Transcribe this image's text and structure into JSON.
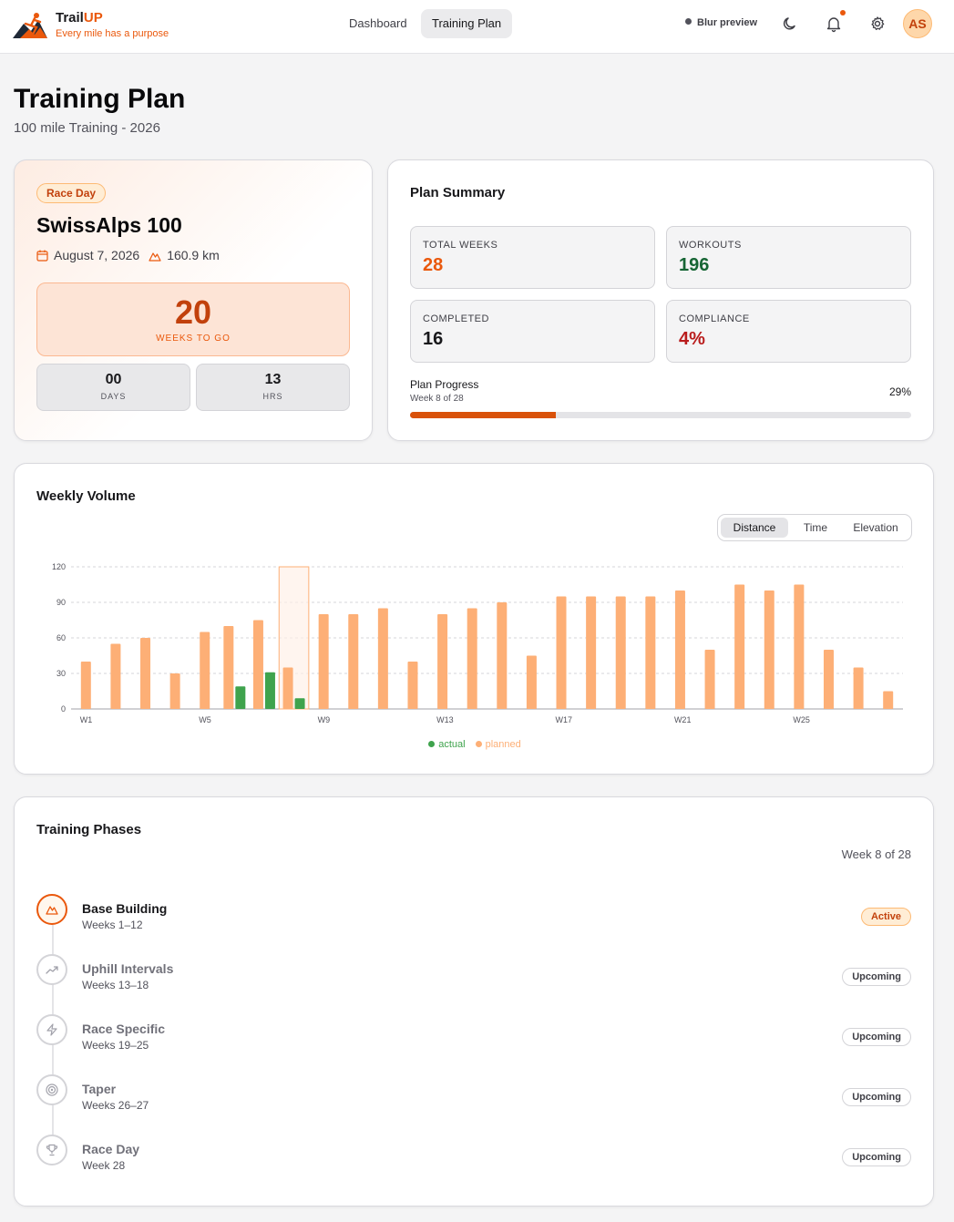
{
  "app": {
    "name_main": "Trail",
    "name_accent": "UP",
    "tagline": "Every mile has a purpose"
  },
  "nav": {
    "items": [
      {
        "label": "Dashboard",
        "active": false
      },
      {
        "label": "Training Plan",
        "active": true
      }
    ]
  },
  "header": {
    "blur_preview": "Blur preview",
    "avatar_initials": "AS",
    "icons": [
      "moon-icon",
      "bell-icon",
      "gear-icon"
    ]
  },
  "page": {
    "title": "Training Plan",
    "subtitle": "100 mile Training - 2026"
  },
  "race": {
    "badge": "Race Day",
    "name": "SwissAlps 100",
    "date": "August 7, 2026",
    "distance": "160.9 km",
    "weeks_value": "20",
    "weeks_label": "WEEKS TO GO",
    "days_value": "00",
    "days_label": "DAYS",
    "hrs_value": "13",
    "hrs_label": "HRS"
  },
  "summary": {
    "title": "Plan Summary",
    "stats": [
      {
        "label": "TOTAL WEEKS",
        "value": "28",
        "color": "#ea580c"
      },
      {
        "label": "WORKOUTS",
        "value": "196",
        "color": "#166534"
      },
      {
        "label": "COMPLETED",
        "value": "16",
        "color": "#18181b"
      },
      {
        "label": "COMPLIANCE",
        "value": "4%",
        "color": "#b91c1c"
      }
    ],
    "progress_title": "Plan Progress",
    "progress_sub": "Week 8 of 28",
    "progress_pct_label": "29%",
    "progress_fraction": 0.29
  },
  "volume": {
    "title": "Weekly Volume",
    "tabs": [
      {
        "label": "Distance",
        "active": true
      },
      {
        "label": "Time",
        "active": false
      },
      {
        "label": "Elevation",
        "active": false
      }
    ],
    "legend_actual": "actual",
    "legend_planned": "planned"
  },
  "chart_data": {
    "type": "bar",
    "categories": [
      "W1",
      "W2",
      "W3",
      "W4",
      "W5",
      "W6",
      "W7",
      "W8",
      "W9",
      "W10",
      "W11",
      "W12",
      "W13",
      "W14",
      "W15",
      "W16",
      "W17",
      "W18",
      "W19",
      "W20",
      "W21",
      "W22",
      "W23",
      "W24",
      "W25",
      "W26",
      "W27",
      "W28"
    ],
    "tick_labels": [
      "W1",
      "W5",
      "W9",
      "W13",
      "W17",
      "W21",
      "W25"
    ],
    "series": [
      {
        "name": "actual",
        "color": "#3fa34d",
        "values": [
          0,
          0,
          0,
          0,
          0,
          19,
          31,
          9,
          0,
          0,
          0,
          0,
          0,
          0,
          0,
          0,
          0,
          0,
          0,
          0,
          0,
          0,
          0,
          0,
          0,
          0,
          0,
          0
        ]
      },
      {
        "name": "planned",
        "color": "#fdaf76",
        "values": [
          40,
          55,
          60,
          30,
          65,
          70,
          75,
          35,
          80,
          80,
          85,
          40,
          80,
          85,
          90,
          45,
          95,
          95,
          95,
          95,
          100,
          50,
          105,
          100,
          105,
          50,
          35,
          15
        ]
      }
    ],
    "highlight_index": 7,
    "ylim": [
      0,
      120
    ],
    "yticks": [
      0,
      30,
      60,
      90,
      120
    ],
    "grid": true,
    "legend": "bottom"
  },
  "phases": {
    "title": "Training Phases",
    "week_label": "Week 8 of 28",
    "items": [
      {
        "name": "Base Building",
        "weeks": "Weeks 1–12",
        "status": "Active",
        "icon": "mountain-icon",
        "active": true
      },
      {
        "name": "Uphill Intervals",
        "weeks": "Weeks 13–18",
        "status": "Upcoming",
        "icon": "trending-up-icon",
        "active": false
      },
      {
        "name": "Race Specific",
        "weeks": "Weeks 19–25",
        "status": "Upcoming",
        "icon": "lightning-icon",
        "active": false
      },
      {
        "name": "Taper",
        "weeks": "Weeks 26–27",
        "status": "Upcoming",
        "icon": "target-icon",
        "active": false
      },
      {
        "name": "Race Day",
        "weeks": "Week 28",
        "status": "Upcoming",
        "icon": "trophy-icon",
        "active": false
      }
    ]
  }
}
